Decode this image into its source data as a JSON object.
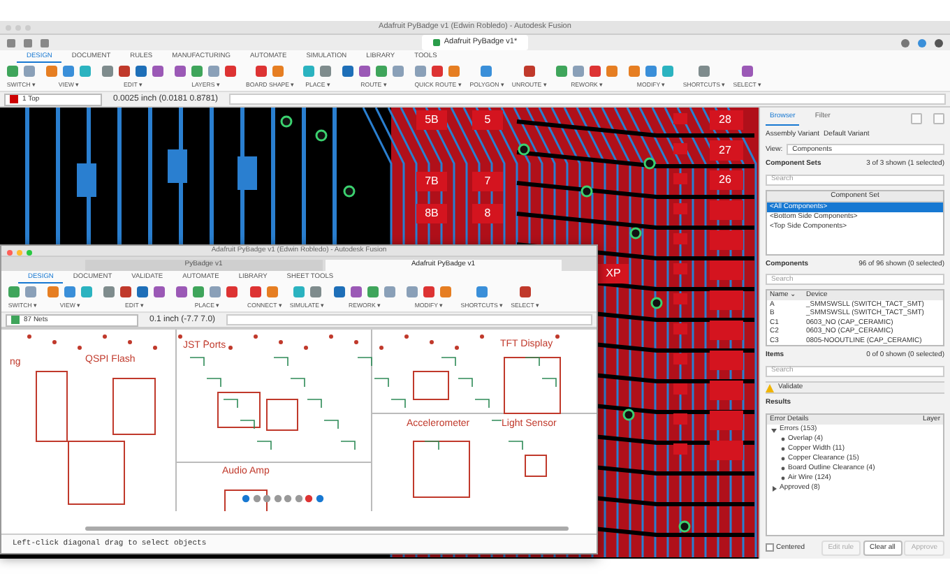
{
  "back_window": {
    "title": "Adafruit PyBadge v1 (Edwin Robledo) - Autodesk Fusion",
    "document_tab": "Adafruit PyBadge v1*",
    "ribbon_tabs": [
      {
        "label": "DESIGN",
        "selected": true
      },
      {
        "label": "DOCUMENT",
        "selected": false
      },
      {
        "label": "RULES",
        "selected": false
      },
      {
        "label": "MANUFACTURING",
        "selected": false
      },
      {
        "label": "AUTOMATE",
        "selected": false
      },
      {
        "label": "SIMULATION",
        "selected": false
      },
      {
        "label": "LIBRARY",
        "selected": false
      },
      {
        "label": "TOOLS",
        "selected": false
      }
    ],
    "tool_groups": [
      "SWITCH ▾",
      "VIEW ▾",
      "EDIT ▾",
      "LAYERS ▾",
      "BOARD SHAPE ▾",
      "PLACE ▾",
      "ROUTE ▾",
      "QUICK ROUTE ▾",
      "POLYGON ▾",
      "UNROUTE ▾",
      "REWORK ▾",
      "MODIFY ▾",
      "SHORTCUTS ▾",
      "SELECT ▾"
    ],
    "layer": "1 Top",
    "coordinates": "0.0025 inch (0.0181 0.8781)",
    "pads": [
      {
        "label": "5B"
      },
      {
        "label": "5"
      },
      {
        "label": "7B"
      },
      {
        "label": "7"
      },
      {
        "label": "8B"
      },
      {
        "label": "8"
      },
      {
        "label": "28"
      },
      {
        "label": "27"
      },
      {
        "label": "26"
      },
      {
        "label": "XP"
      }
    ]
  },
  "inspector": {
    "tabs": [
      {
        "label": "Browser",
        "selected": true
      },
      {
        "label": "Filter",
        "selected": false
      }
    ],
    "assembly_variant": {
      "label": "Assembly Variant",
      "value": "Default Variant"
    },
    "view": {
      "label": "View:",
      "value": "Components"
    },
    "component_sets": {
      "title": "Component Sets",
      "count": "3 of 3 shown (1 selected)",
      "search_placeholder": "Search",
      "column": "Component Set",
      "rows": [
        {
          "label": "<All Components>",
          "selected": true
        },
        {
          "label": "<Bottom Side Components>",
          "selected": false
        },
        {
          "label": "<Top Side Components>",
          "selected": false
        }
      ]
    },
    "components": {
      "title": "Components",
      "count": "96 of 96 shown (0 selected)",
      "search_placeholder": "Search",
      "columns": [
        "Name ⌄",
        "Device"
      ],
      "rows": [
        [
          "A",
          "_SMMSWSLL (SWITCH_TACT_SMT)"
        ],
        [
          "B",
          "_SMMSWSLL (SWITCH_TACT_SMT)"
        ],
        [
          "C1",
          "0603_NO (CAP_CERAMIC)"
        ],
        [
          "C2",
          "0603_NO (CAP_CERAMIC)"
        ],
        [
          "C3",
          "0805-NOOUTLINE (CAP_CERAMIC)"
        ]
      ]
    },
    "items": {
      "title": "Items",
      "count": "0 of 0 shown (0 selected)",
      "search_placeholder": "Search"
    },
    "validate": "Validate",
    "results": {
      "title": "Results",
      "columns": [
        "Error Details",
        "Layer"
      ],
      "tree": [
        {
          "label": "Errors (153)",
          "expanded": true,
          "children": [
            {
              "label": "Overlap (4)"
            },
            {
              "label": "Copper Width (11)"
            },
            {
              "label": "Copper Clearance (15)"
            },
            {
              "label": "Board Outline Clearance (4)"
            },
            {
              "label": "Air Wire (124)"
            }
          ]
        },
        {
          "label": "Approved (8)",
          "expanded": false
        }
      ]
    },
    "centered": {
      "label": "Centered",
      "checked": false
    },
    "buttons": [
      {
        "label": "Edit rule",
        "disabled": true
      },
      {
        "label": "Clear all",
        "disabled": false
      },
      {
        "label": "Approve",
        "disabled": true
      }
    ]
  },
  "front_window": {
    "title": "Adafruit PyBadge v1 (Edwin Robledo) - Autodesk Fusion",
    "document_tabs": [
      {
        "label": "PyBadge v1",
        "selected": false
      },
      {
        "label": "Adafruit PyBadge v1",
        "selected": true
      }
    ],
    "ribbon_tabs": [
      {
        "label": "DESIGN",
        "selected": true
      },
      {
        "label": "DOCUMENT",
        "selected": false
      },
      {
        "label": "VALIDATE",
        "selected": false
      },
      {
        "label": "AUTOMATE",
        "selected": false
      },
      {
        "label": "LIBRARY",
        "selected": false
      },
      {
        "label": "SHEET TOOLS",
        "selected": false
      }
    ],
    "tool_groups": [
      "SWITCH ▾",
      "VIEW ▾",
      "EDIT ▾",
      "PLACE ▾",
      "CONNECT ▾",
      "SIMULATE ▾",
      "REWORK ▾",
      "MODIFY ▾",
      "SHORTCUTS ▾",
      "SELECT ▾"
    ],
    "net_filter": "87 Nets",
    "coordinates": "0.1 inch (-7.7 7.0)",
    "sheet_titles": [
      "ng",
      "QSPI Flash",
      "JST Ports",
      "TFT Display",
      "Accelerometer",
      "Light Sensor",
      "Audio Amp"
    ],
    "status": "Left-click diagonal drag to select objects"
  }
}
